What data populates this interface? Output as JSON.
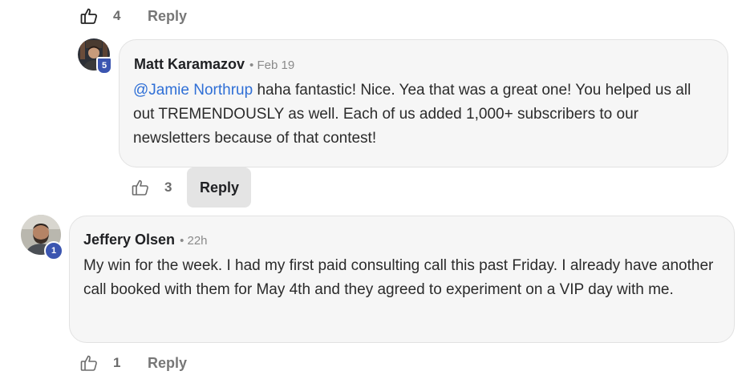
{
  "top_actions": {
    "like_count": "4",
    "reply_label": "Reply"
  },
  "comments": [
    {
      "author": "Matt Karamazov",
      "time": "• Feb 19",
      "level": "5",
      "mention": "@Jamie Northrup",
      "text": " haha fantastic! Nice. Yea that was a great one! You helped us all out TREMENDOUSLY as well. Each of us added 1,000+ subscribers to our newsletters because of that contest!",
      "like_count": "3",
      "reply_label": "Reply"
    },
    {
      "author": "Jeffery Olsen",
      "time": "• 22h",
      "level": "1",
      "text": "My win for the week. I had my first paid consulting call this past Friday. I already have another call booked with them for May 4th and they agreed to experiment on a VIP day with me.",
      "like_count": "1",
      "reply_label": "Reply"
    }
  ],
  "colors": {
    "mention": "#2f6fd6",
    "badge": "#3b55b0",
    "bubble": "#f6f6f6"
  },
  "icons": {
    "like": "thumbs-up-icon"
  }
}
